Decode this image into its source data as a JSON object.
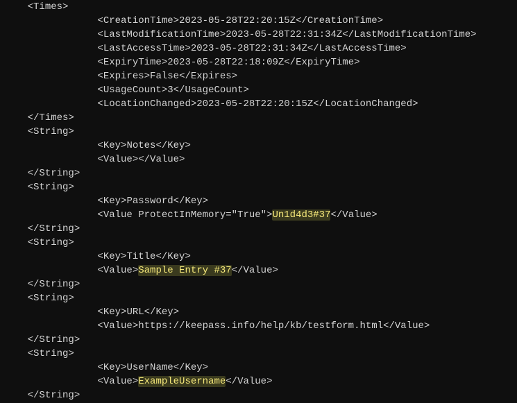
{
  "indent": "        ",
  "halfIndent": "    ",
  "times": {
    "open": "<Times>",
    "close": "</Times>",
    "CreationTime": "2023-05-28T22:20:15Z",
    "LastModificationTime": "2023-05-28T22:31:34Z",
    "LastAccessTime": "2023-05-28T22:31:34Z",
    "ExpiryTime": "2023-05-28T22:18:09Z",
    "Expires": "False",
    "UsageCount": "3",
    "LocationChanged": "2023-05-28T22:20:15Z"
  },
  "strings": [
    {
      "key": "Notes",
      "value": "",
      "protect": false,
      "hlValue": false
    },
    {
      "key": "Password",
      "value": "Un1d4d3#37",
      "protect": true,
      "hlValue": true
    },
    {
      "key": "Title",
      "value": "Sample Entry #37",
      "protect": false,
      "hlValue": true
    },
    {
      "key": "URL",
      "value": "https://keepass.info/help/kb/testform.html",
      "protect": false,
      "hlValue": false
    },
    {
      "key": "UserName",
      "value": "ExampleUsername",
      "protect": false,
      "hlValue": true
    }
  ],
  "tokens": {
    "stringOpen": "<String>",
    "stringClose": "</String>",
    "keyOpen": "<Key>",
    "keyClose": "</Key>",
    "valueOpen": "<Value>",
    "valueClose": "</Value>",
    "protectAttr": " ProtectInMemory=\"True\""
  }
}
